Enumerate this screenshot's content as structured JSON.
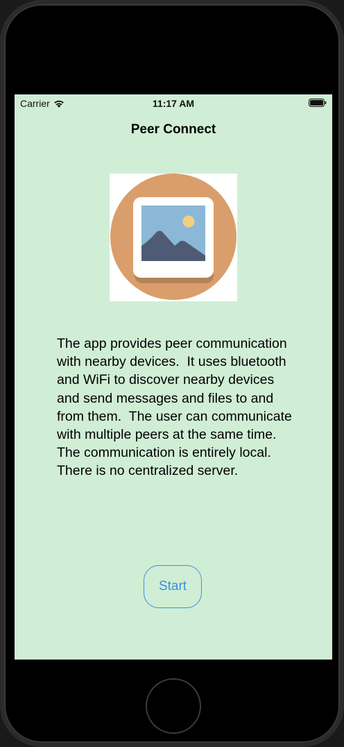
{
  "status_bar": {
    "carrier": "Carrier",
    "time": "11:17 AM",
    "wifi_icon": "wifi-icon",
    "battery_icon": "battery-icon"
  },
  "nav": {
    "title": "Peer Connect"
  },
  "image": {
    "icon": "photo-icon"
  },
  "description": "The app provides peer communication with nearby devices.  It uses bluetooth and WiFi to discover nearby devices and send messages and files to and from them.  The user can communicate with multiple peers at the same time.   The communication is entirely local.  There is no centralized server.",
  "start_button": {
    "label": "Start"
  },
  "colors": {
    "background": "#d0eed5",
    "accent": "#3b8fe3"
  }
}
